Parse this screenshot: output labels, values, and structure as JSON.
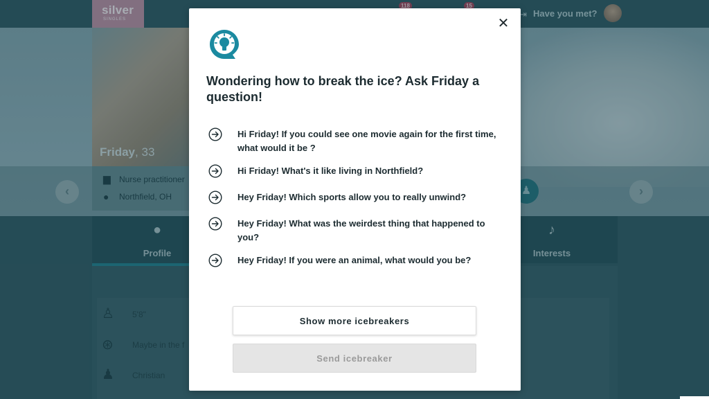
{
  "header": {
    "logo_text": "silver",
    "logo_subtext": "SINGLES",
    "badge_1": "118",
    "badge_2": "15",
    "have_you_met": "Have you met?"
  },
  "profile": {
    "name": "Friday",
    "age": "33",
    "occupation": "Nurse practitioner",
    "location": "Northfield, OH"
  },
  "tabs": {
    "profile": "Profile",
    "interests": "Interests"
  },
  "details": {
    "height": "5'8\"",
    "children": "Maybe in the f",
    "religion": "Christian"
  },
  "modal": {
    "title": "Wondering how to break the ice? Ask Friday a question!",
    "questions": [
      "Hi Friday! If you could see one movie again for the first time, what would it be ?",
      "Hi Friday! What's it like living in Northfield?",
      "Hey Friday! Which sports allow you to really unwind?",
      "Hey Friday! What was the weirdest thing that happened to you?",
      "Hey Friday! If you were an animal, what would you be?"
    ],
    "show_more_label": "Show more icebreakers",
    "send_label": "Send icebreaker",
    "accent_color": "#1b8aa0"
  }
}
